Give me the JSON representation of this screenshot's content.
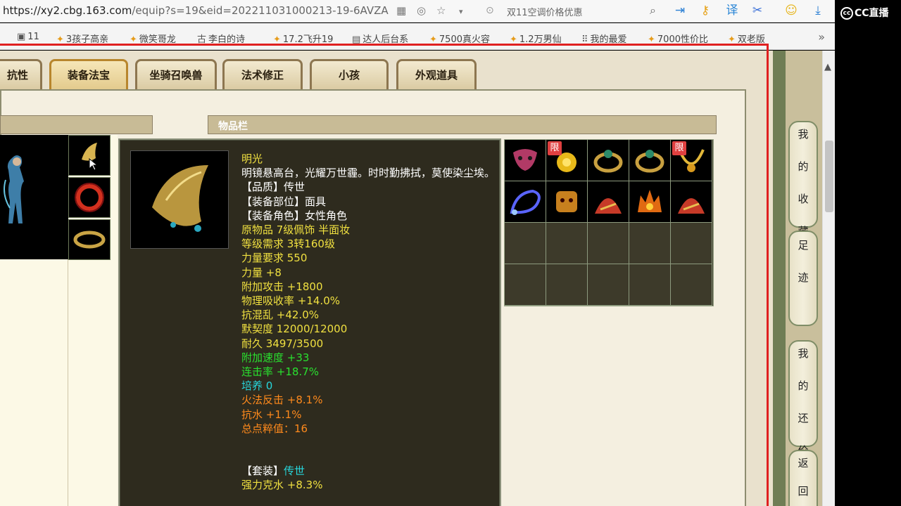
{
  "browser": {
    "url_host": "https://xy2.cbg.163.com",
    "url_path": "/equip?s=19&eid=202211031000213-19-6AVZA",
    "search_text": "双11空调价格优惠",
    "bookmarks": [
      "11",
      "3孩子高亲",
      "微笑哥龙",
      "李白的诗",
      "17.2飞升19",
      "达人后台系",
      "7500真火容",
      "1.2万男仙",
      "我的最爱",
      "7000性价比",
      "双老版"
    ],
    "more_label": "»"
  },
  "overlay": {
    "logo_text": "CC直播",
    "logo_mark": "cc"
  },
  "tabs": [
    "抗性",
    "装备法宝",
    "坐骑召唤兽",
    "法术修正",
    "小孩",
    "外观道具"
  ],
  "active_tab": "装备法宝",
  "items_panel_title": "物品栏",
  "tooltip": {
    "name": "明光",
    "description": "明镜悬高台，光耀万世霾。时时勤拂拭，莫使染尘埃。",
    "lines_white": [
      "【品质】传世",
      "【装备部位】面具",
      "【装备角色】女性角色"
    ],
    "lines_yellow": [
      "原物品 7级佩饰 半面妆",
      "等级需求 3转160级",
      "力量要求 550",
      "力量 +8",
      "附加攻击 +1800",
      "物理吸收率 +14.0%",
      "抗混乱 +42.0%",
      "默契度 12000/12000",
      "耐久 3497/3500"
    ],
    "lines_green": [
      "附加速度 +33",
      "连击率 +18.7%"
    ],
    "line_cyan": "培养 0",
    "lines_orange": [
      "火法反击 +8.1%",
      "抗水 +1.1%",
      "总点粹值：16"
    ],
    "set_label": "【套装】",
    "set_value": "传世",
    "set_bonus": "强力克水 +8.3%"
  },
  "inventory": {
    "limit_badge": "限",
    "slot_icons": [
      "mask-icon",
      "gold-flower-icon",
      "jade-ring-icon",
      "jade-ring-icon",
      "gold-necklace-icon",
      "blue-orb-icon",
      "lion-head-icon",
      "red-hat-icon",
      "fire-crown-icon",
      "red-hat-icon"
    ]
  },
  "side_buttons": [
    {
      "label": [
        "我",
        "的",
        "收",
        "藏"
      ]
    },
    {
      "label": [
        "足",
        "迹"
      ]
    },
    {
      "label": [
        "我",
        "的",
        "还",
        "价"
      ]
    },
    {
      "label": [
        "返",
        "回"
      ]
    }
  ],
  "colors": {
    "red_frame": "#e02020",
    "tooltip_bg": "#2e2b1e",
    "gold": "#f0e040",
    "green": "#29e02f",
    "cyan": "#27d6dc",
    "orange": "#ff8a1c"
  }
}
